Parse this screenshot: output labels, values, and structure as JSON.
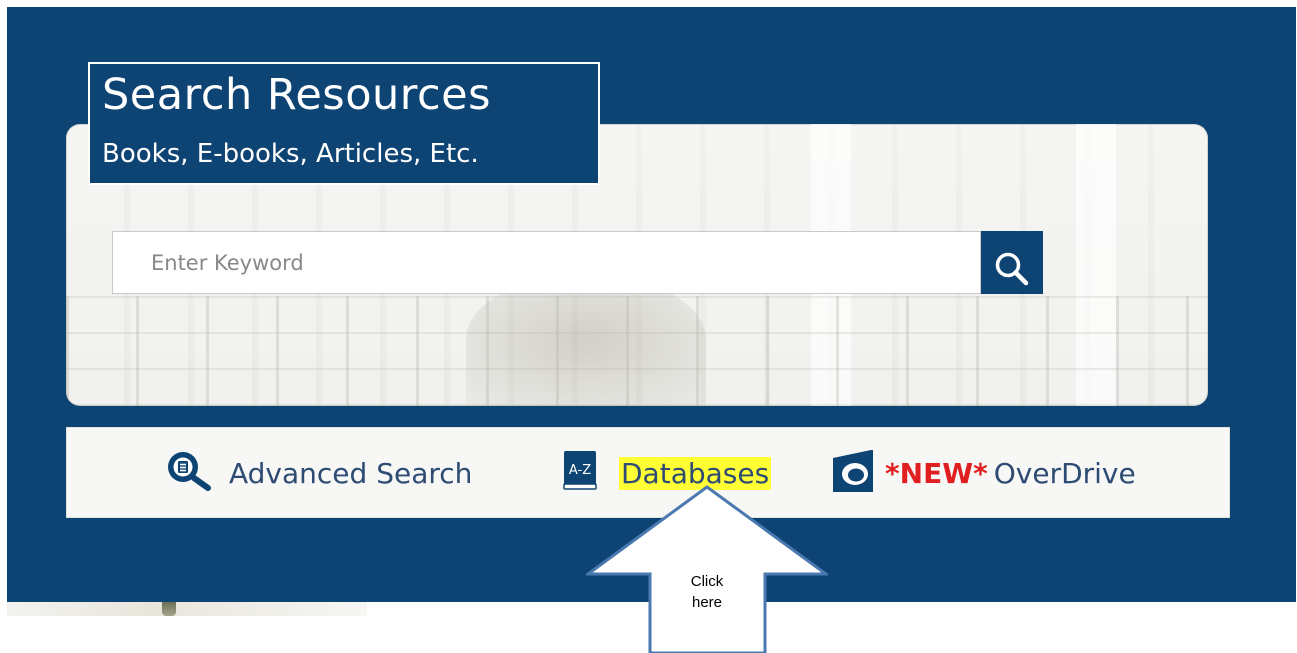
{
  "header": {
    "title": "Search Resources",
    "subtitle": "Books, E-books, Articles, Etc."
  },
  "search": {
    "placeholder": "Enter Keyword",
    "value": "",
    "button_icon": "search-icon"
  },
  "links": [
    {
      "label": "Advanced Search",
      "icon": "advanced-search-icon"
    },
    {
      "label": "Databases",
      "icon": "a-z-book-icon",
      "highlight_color": "#ffff33"
    },
    {
      "new_tag": "*NEW*",
      "label": "OverDrive",
      "icon": "overdrive-logo-icon"
    }
  ],
  "callout": {
    "line1": "Click",
    "line2": "here"
  },
  "colors": {
    "panel": "#0d4473",
    "link_text": "#2d4b73",
    "new_tag": "#e02020",
    "highlight": "#ffff33",
    "arrow_stroke": "#4a78b0"
  }
}
